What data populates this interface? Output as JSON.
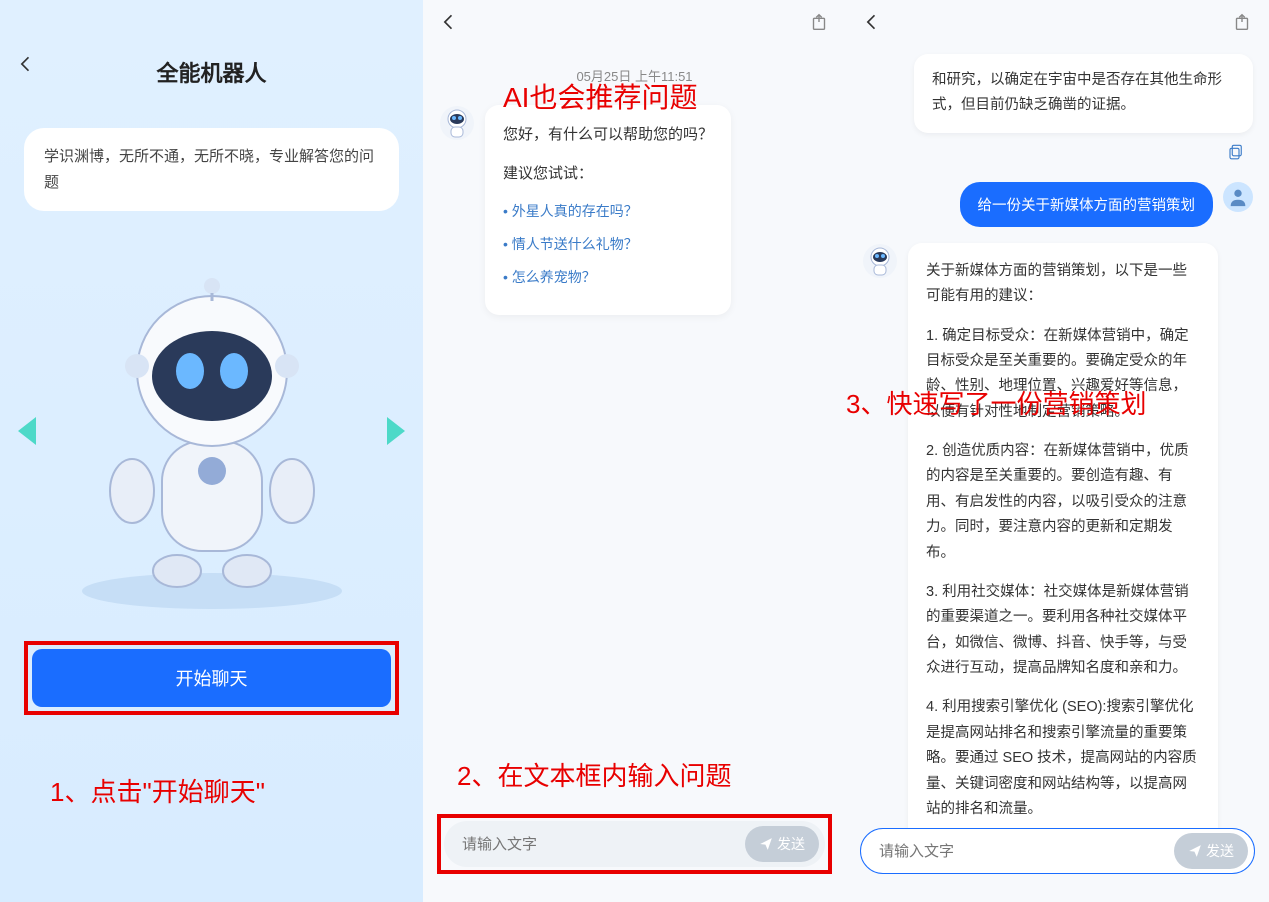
{
  "panel1": {
    "title": "全能机器人",
    "description": "学识渊博，无所不通，无所不晓，专业解答您的问题",
    "start_button": "开始聊天",
    "annotation": "1、点击\"开始聊天\""
  },
  "panel2": {
    "timestamp": "05月25日  上午11:51",
    "annotation_top": "AI也会推荐问题",
    "greeting": "您好，有什么可以帮助您的吗？",
    "suggest_label": "建议您试试：",
    "suggestions": [
      "外星人真的存在吗？",
      "情人节送什么礼物？",
      "怎么养宠物？"
    ],
    "input_placeholder": "请输入文字",
    "send_label": "发送",
    "annotation_bottom": "2、在文本框内输入问题"
  },
  "panel3": {
    "top_reply": "和研究，以确定在宇宙中是否存在其他生命形式，但目前仍缺乏确凿的证据。",
    "user_message": "给一份关于新媒体方面的营销策划",
    "bot_intro": "关于新媒体方面的营销策划，以下是一些可能有用的建议：",
    "bot_points": [
      "1. 确定目标受众：在新媒体营销中，确定目标受众是至关重要的。要确定受众的年龄、性别、地理位置、兴趣爱好等信息，以便有针对性地制定营销策略。",
      "2. 创造优质内容：在新媒体营销中，优质的内容是至关重要的。要创造有趣、有用、有启发性的内容，以吸引受众的注意力。同时，要注意内容的更新和定期发布。",
      "3. 利用社交媒体：社交媒体是新媒体营销的重要渠道之一。要利用各种社交媒体平台，如微信、微博、抖音、快手等，与受众进行互动，提高品牌知名度和亲和力。",
      "4. 利用搜索引擎优化 (SEO):搜索引擎优化是提高网站排名和搜索引擎流量的重要策略。要通过 SEO 技术，提高网站的内容质量、关键词密度和网站结构等，以提高网站的排名和流量。"
    ],
    "annotation": "3、快速写了一份营销策划",
    "input_placeholder": "请输入文字",
    "send_label": "发送"
  }
}
